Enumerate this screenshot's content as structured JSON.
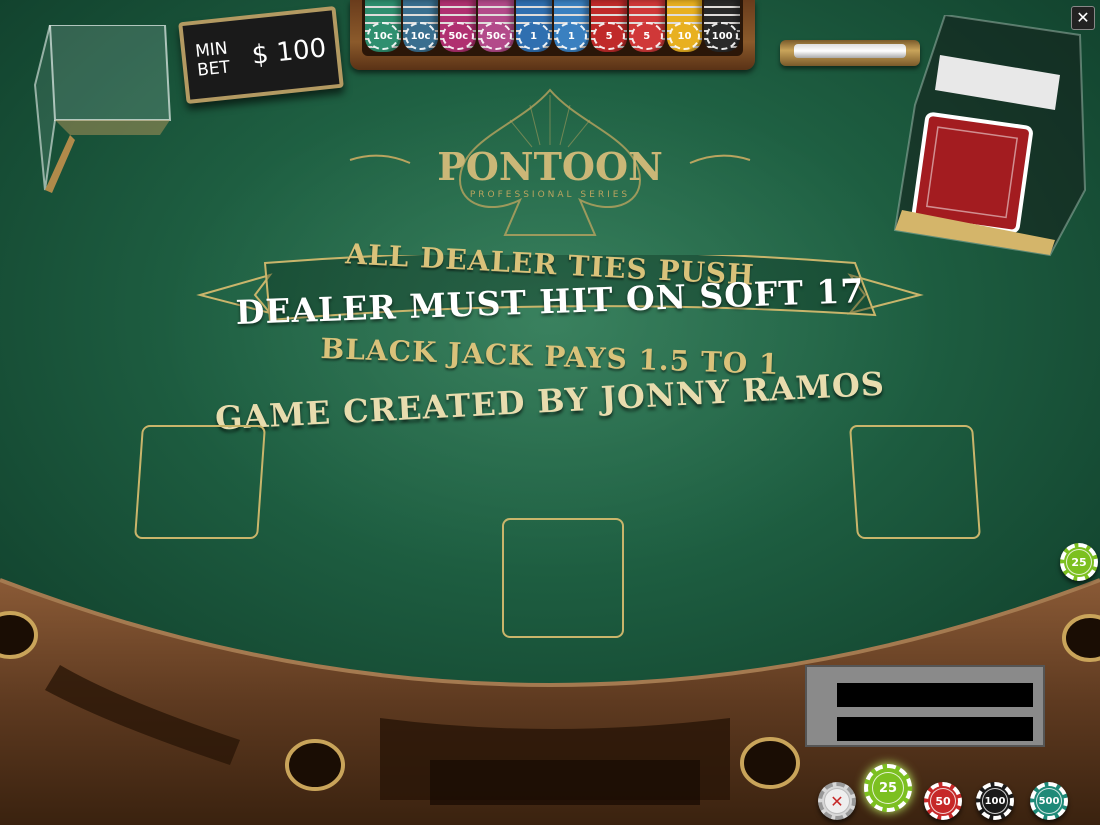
{
  "table": {
    "logo_title": "PONTOON",
    "logo_subtitle": "PROFESSIONAL SERIES",
    "rules": {
      "push": "ALL DEALER TIES PUSH",
      "soft17": "DEALER MUST HIT ON SOFT 17",
      "blackjack": "BLACK JACK PAYS 1.5 TO 1"
    },
    "credit": "GAME CREATED BY JONNY RAMOS"
  },
  "min_bet": {
    "label_line1": "MIN",
    "label_line2": "BET",
    "amount": "$ 100"
  },
  "chip_tray": {
    "stacks": [
      {
        "label": "10c",
        "color": "#2f8f6f"
      },
      {
        "label": "10c",
        "color": "#3a6f8f"
      },
      {
        "label": "50c",
        "color": "#b03070"
      },
      {
        "label": "50c",
        "color": "#b34a8a"
      },
      {
        "label": "1",
        "color": "#2f6fb0"
      },
      {
        "label": "1",
        "color": "#3a80c0"
      },
      {
        "label": "5",
        "color": "#c02a2a"
      },
      {
        "label": "5",
        "color": "#d03838"
      },
      {
        "label": "10",
        "color": "#e8b020"
      },
      {
        "label": "100",
        "color": "#2a2a2a"
      }
    ]
  },
  "chips": {
    "side": "25",
    "selected": "25",
    "c50": "50",
    "c100": "100",
    "c500": "500"
  },
  "colors": {
    "felt": "#1f6143",
    "gold": "#d9c27a",
    "chip25": "#7cc020",
    "chip50": "#c62828",
    "chip100": "#1a1a1a",
    "chip500": "#1f8a78"
  }
}
